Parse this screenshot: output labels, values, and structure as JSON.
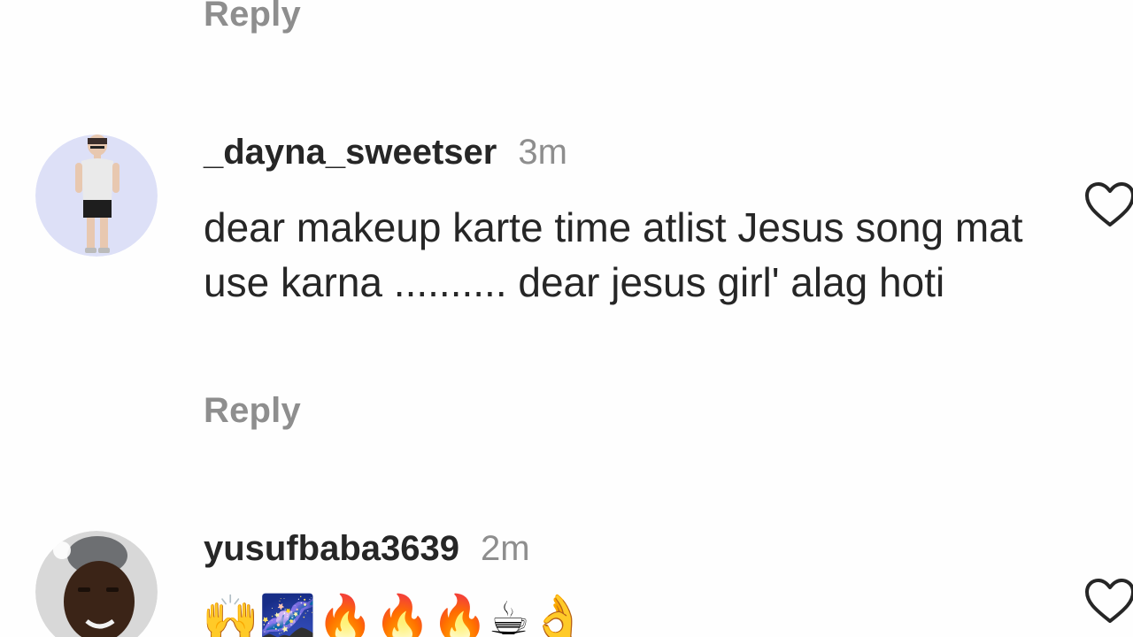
{
  "reply_label": "Reply",
  "comments": [
    {
      "username": "_dayna_sweetser",
      "time": "3m",
      "text": "dear makeup karte time atlist Jesus song mat use karna .......... dear jesus girl' alag hoti",
      "reply_label": "Reply"
    },
    {
      "username": "yusufbaba3639",
      "time": "2m",
      "text": "🙌🌌🔥🔥🔥☕👌"
    }
  ],
  "colors": {
    "text": "#262626",
    "muted": "#8e8e8e",
    "background": "#ffffff"
  }
}
